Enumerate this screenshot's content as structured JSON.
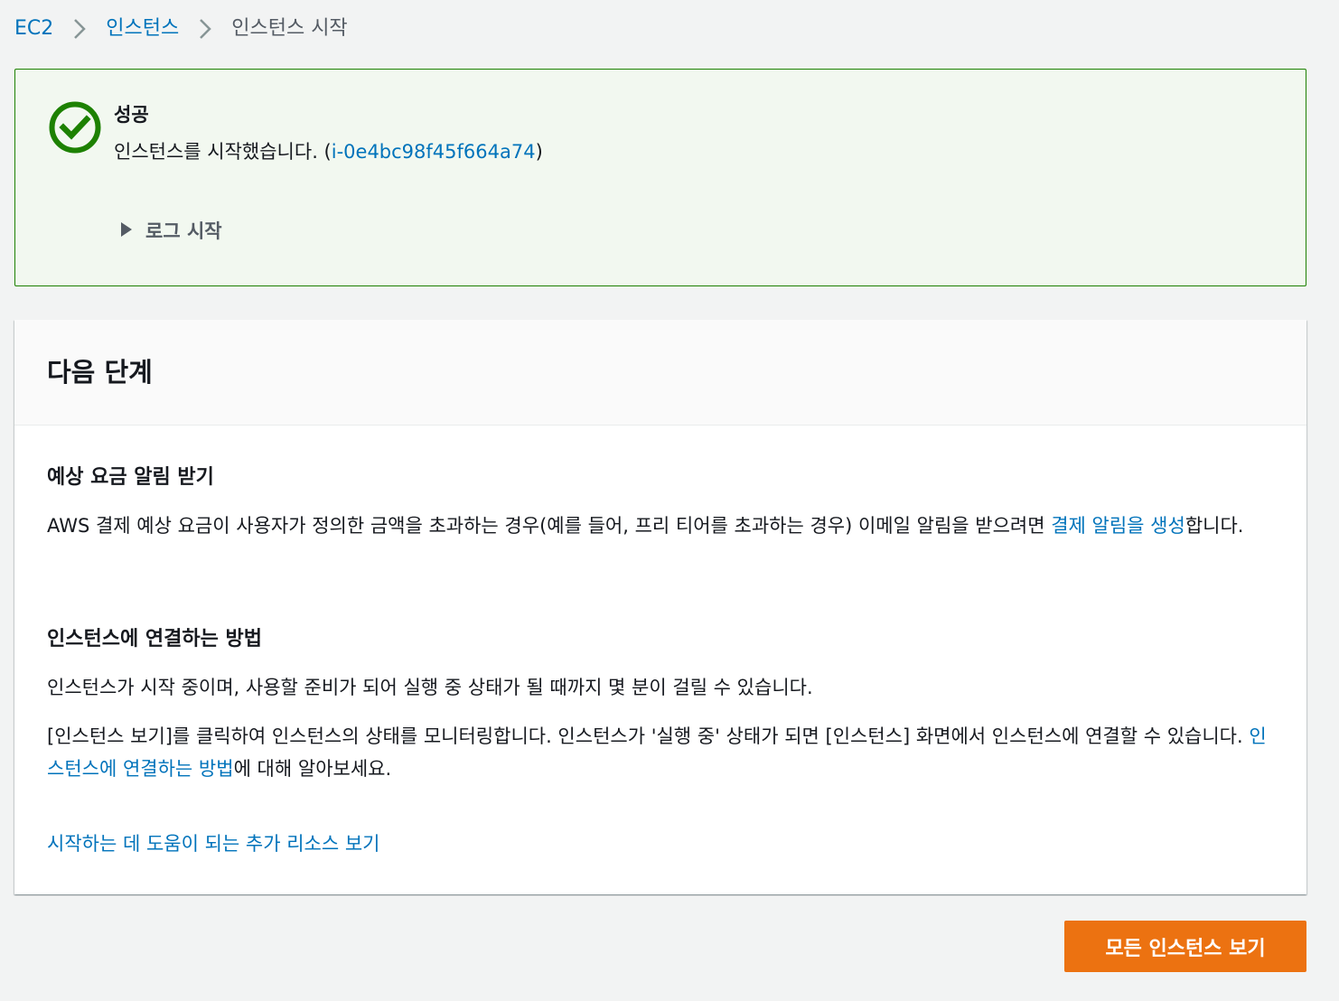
{
  "breadcrumb": {
    "items": [
      {
        "label": "EC2"
      },
      {
        "label": "인스턴스"
      }
    ],
    "current": "인스턴스 시작"
  },
  "flash": {
    "title": "성공",
    "message_prefix": "인스턴스를 시작했습니다. (",
    "instance_id": "i-0e4bc98f45f664a74",
    "message_suffix": ")",
    "log_label": "로그 시작",
    "icon": "success-check-icon",
    "color": "#1d8102"
  },
  "next_steps": {
    "title": "다음 단계",
    "billing": {
      "title": "예상 요금 알림 받기",
      "text_prefix": "AWS 결제 예상 요금이 사용자가 정의한 금액을 초과하는 경우(예를 들어, 프리 티어를 초과하는 경우) 이메일 알림을 받으려면 ",
      "link": "결제 알림을 생성",
      "text_suffix": "합니다."
    },
    "connect": {
      "title": "인스턴스에 연결하는 방법",
      "text1": "인스턴스가 시작 중이며, 사용할 준비가 되어 실행 중 상태가 될 때까지 몇 분이 걸릴 수 있습니다.",
      "text2_prefix": "[인스턴스 보기]를 클릭하여 인스턴스의 상태를 모니터링합니다. 인스턴스가 '실행 중' 상태가 되면 [인스턴스] 화면에서 인스턴스에 연결할 수 있습니다. ",
      "text2_link": "인스턴스에 연결하는 방법",
      "text2_suffix": "에 대해 알아보세요."
    },
    "more_link": "시작하는 데 도움이 되는 추가 리소스 보기"
  },
  "actions": {
    "view_all_label": "모든 인스턴스 보기"
  },
  "colors": {
    "link": "#0073bb",
    "primary": "#ec7211",
    "success_bg": "#f2f8f0"
  }
}
